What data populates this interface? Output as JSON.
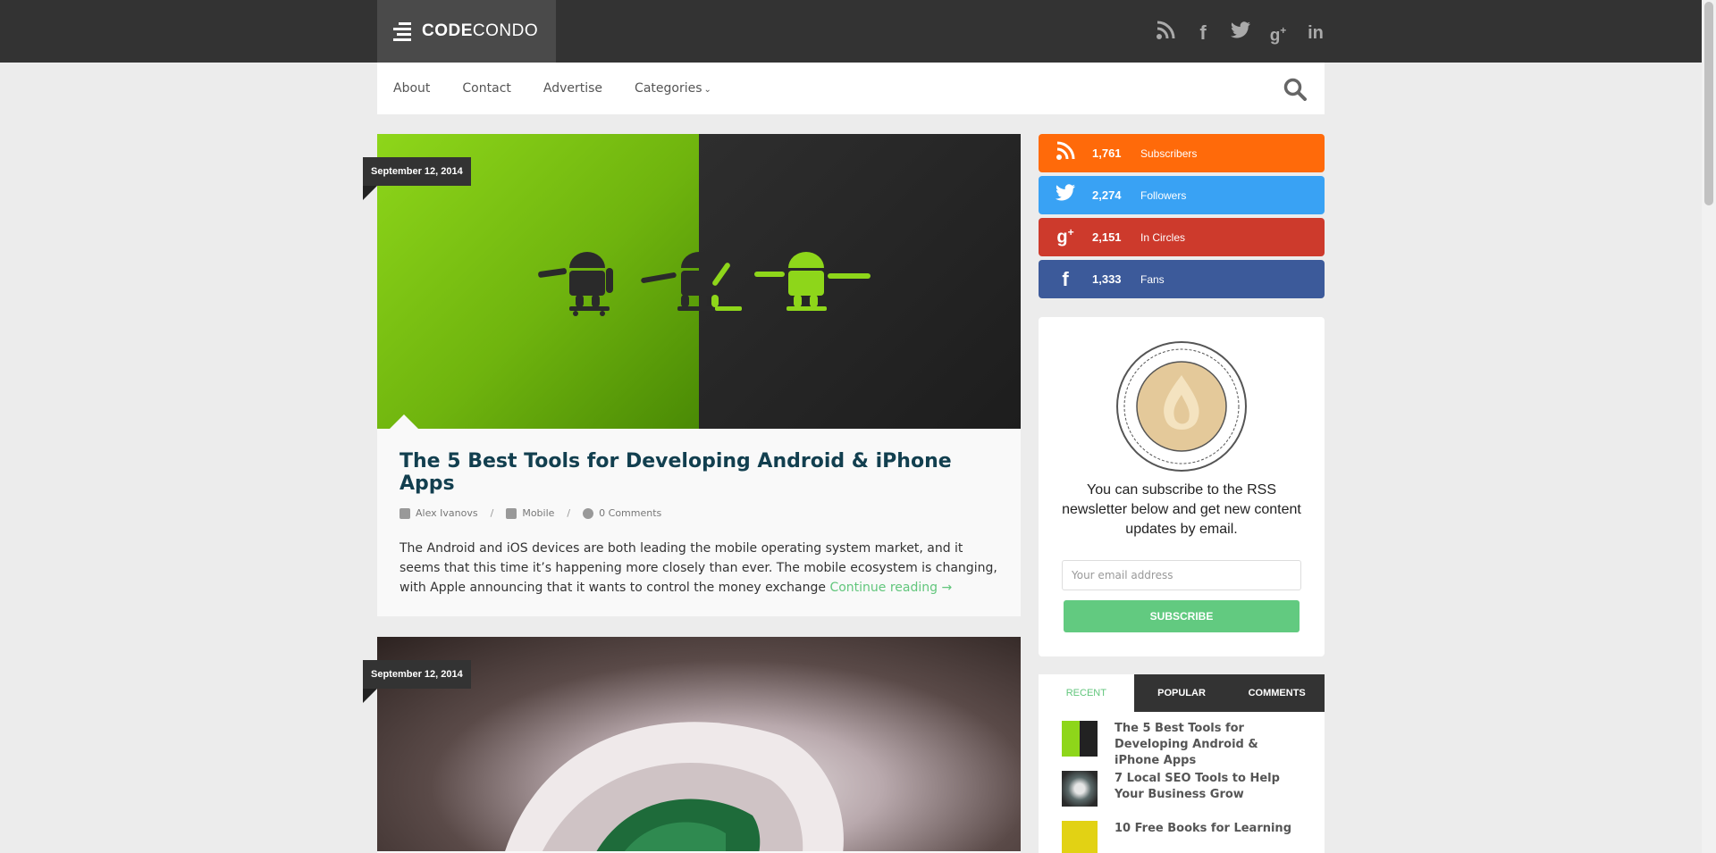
{
  "site": {
    "logo_bold": "CODE",
    "logo_rest": "CONDO"
  },
  "top_social": [
    "rss-icon",
    "facebook-icon",
    "twitter-icon",
    "googleplus-icon",
    "linkedin-icon"
  ],
  "nav": {
    "items": [
      "About",
      "Contact",
      "Advertise",
      "Categories"
    ],
    "categories_chevron": "⌄"
  },
  "posts": [
    {
      "date": "September 12, 2014",
      "title": "The 5 Best Tools for Developing Android & iPhone Apps",
      "author": "Alex Ivanovs",
      "category": "Mobile",
      "comments": "0 Comments",
      "excerpt": "The Android and iOS devices are both leading the mobile operating system market, and it seems that this time it’s happening more closely than ever. The mobile ecosystem is changing, with Apple announcing that it wants to control the money exchange ",
      "continue": "Continue reading →"
    },
    {
      "date": "September 12, 2014"
    }
  ],
  "counters": [
    {
      "count": "1,761",
      "label": "Subscribers",
      "icon": "rss-icon",
      "color": "#ff6a0a"
    },
    {
      "count": "2,274",
      "label": "Followers",
      "icon": "twitter-icon",
      "color": "#39a2f4"
    },
    {
      "count": "2,151",
      "label": "In Circles",
      "icon": "googleplus-icon",
      "color": "#cd3a2c"
    },
    {
      "count": "1,333",
      "label": "Fans",
      "icon": "facebook-icon",
      "color": "#3c5a9a"
    }
  ],
  "feedburner": {
    "text": "You can subscribe to the RSS newsletter below and get new content updates by email.",
    "email_placeholder": "Your email address",
    "button": "SUBSCRIBE"
  },
  "tabs": {
    "labels": [
      "RECENT",
      "POPULAR",
      "COMMENTS"
    ],
    "active": "RECENT",
    "items": [
      "The 5 Best Tools for Developing Android & iPhone Apps",
      "7 Local SEO Tools to Help Your Business Grow",
      "10 Free Books for Learning"
    ]
  },
  "colors": {
    "accent_green": "#62ca80",
    "title_blue": "#123f4f",
    "topbar": "#333333"
  }
}
